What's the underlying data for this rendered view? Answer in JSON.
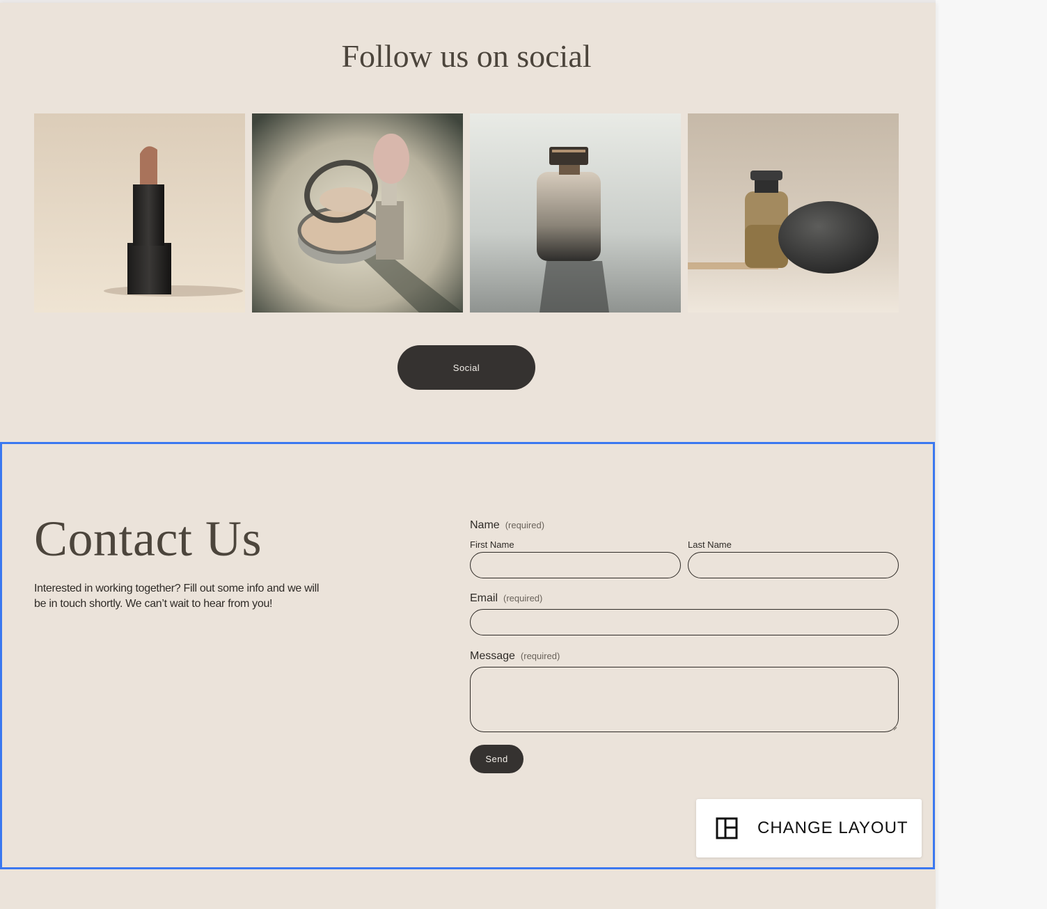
{
  "social": {
    "title": "Follow us on social",
    "images": [
      {
        "name": "lipstick-photo"
      },
      {
        "name": "compact-and-brush-photo"
      },
      {
        "name": "perfume-bottle-photo"
      },
      {
        "name": "serum-bottle-and-stone-photo"
      }
    ],
    "button_label": "Social"
  },
  "contact": {
    "title": "Contact Us",
    "description": "Interested in working together? Fill out some info and we will be in touch shortly. We can’t wait to hear from you!",
    "form": {
      "name_label": "Name",
      "required_note": "(required)",
      "first_name_label": "First Name",
      "last_name_label": "Last Name",
      "first_name_value": "",
      "last_name_value": "",
      "email_label": "Email",
      "email_value": "",
      "message_label": "Message",
      "message_value": "",
      "send_label": "Send"
    }
  },
  "editor": {
    "change_layout_label": "CHANGE LAYOUT",
    "change_layout_icon": "layout-icon",
    "selection_color": "#3b78f0"
  },
  "colors": {
    "page_background": "#ebe3da",
    "heading": "#4c453c",
    "button": "#353230"
  }
}
